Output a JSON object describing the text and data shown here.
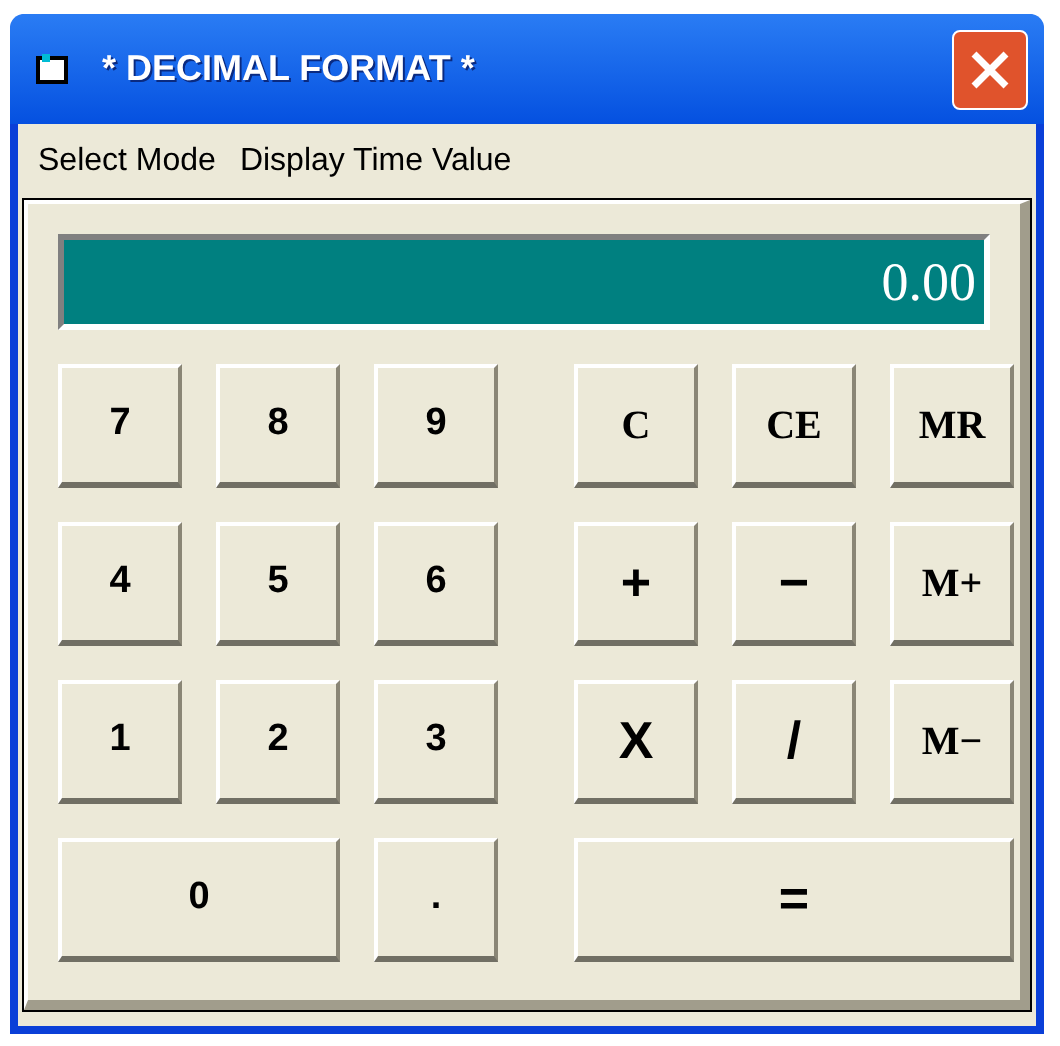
{
  "window": {
    "title": "* DECIMAL FORMAT *"
  },
  "menu": [
    "Select Mode",
    "Display Time Value"
  ],
  "display": {
    "value": "0.00"
  },
  "keypad": [
    {
      "label": "7",
      "kind": "digit",
      "wide": false
    },
    {
      "label": "8",
      "kind": "digit",
      "wide": false
    },
    {
      "label": "9",
      "kind": "digit",
      "wide": false
    },
    {
      "label": "4",
      "kind": "digit",
      "wide": false
    },
    {
      "label": "5",
      "kind": "digit",
      "wide": false
    },
    {
      "label": "6",
      "kind": "digit",
      "wide": false
    },
    {
      "label": "1",
      "kind": "digit",
      "wide": false
    },
    {
      "label": "2",
      "kind": "digit",
      "wide": false
    },
    {
      "label": "3",
      "kind": "digit",
      "wide": false
    },
    {
      "label": "0",
      "kind": "digit",
      "wide": true
    },
    {
      "label": ".",
      "kind": "digit",
      "wide": false
    }
  ],
  "functions": [
    {
      "label": "C",
      "kind": "function",
      "wide": false
    },
    {
      "label": "CE",
      "kind": "function",
      "wide": false
    },
    {
      "label": "MR",
      "kind": "function",
      "wide": false
    },
    {
      "label": "+",
      "kind": "operator",
      "wide": false
    },
    {
      "label": "−",
      "kind": "operator",
      "wide": false
    },
    {
      "label": "M+",
      "kind": "function",
      "wide": false
    },
    {
      "label": "X",
      "kind": "operator",
      "wide": false
    },
    {
      "label": "/",
      "kind": "operator",
      "wide": false
    },
    {
      "label": "M−",
      "kind": "function",
      "wide": false
    },
    {
      "label": "=",
      "kind": "operator",
      "wide": true
    }
  ]
}
